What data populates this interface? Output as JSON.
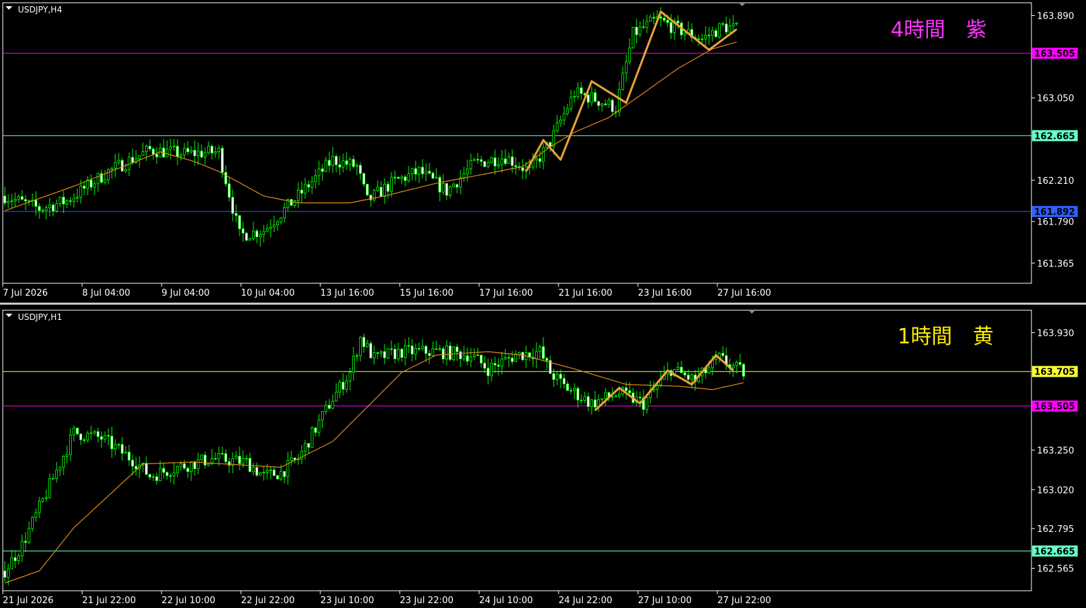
{
  "colors": {
    "background": "#000000",
    "bull": "#00ff00",
    "bear_fill": "#ffffff",
    "ma": "#e08a17",
    "zigzag": "#e8a33a",
    "axis": "#ffffff",
    "magenta": "#ff00ff",
    "cyan": "#66ffcc",
    "blue": "#2f5fff",
    "yellow": "#ffff33"
  },
  "chart_data": [
    {
      "type": "candlestick",
      "symbol": "USDJPY,H4",
      "title": "4時間　紫",
      "title_color": "#ff33ff",
      "ylim": [
        161.16,
        164.02
      ],
      "y_ticks": [
        "163.890",
        "163.050",
        "162.210",
        "161.790",
        "161.365"
      ],
      "x_labels": [
        "7 Jul 2026",
        "8 Jul 04:00",
        "9 Jul 04:00",
        "10 Jul 04:00",
        "13 Jul 16:00",
        "15 Jul 16:00",
        "17 Jul 16:00",
        "21 Jul 16:00",
        "23 Jul 16:00",
        "27 Jul 16:00"
      ],
      "levels": [
        {
          "value": 163.505,
          "label": "163.505",
          "color": "#ff00ff"
        },
        {
          "value": 162.665,
          "label": "162.665",
          "color": "#66ffcc"
        },
        {
          "value": 161.892,
          "label": "161.892",
          "color": "#2f5fff"
        }
      ],
      "anchors": [
        [
          0,
          162.05
        ],
        [
          10,
          161.92
        ],
        [
          18,
          162.0
        ],
        [
          30,
          162.3
        ],
        [
          42,
          162.52
        ],
        [
          52,
          162.48
        ],
        [
          62,
          162.5
        ],
        [
          68,
          161.65
        ],
        [
          75,
          161.7
        ],
        [
          85,
          162.05
        ],
        [
          95,
          162.42
        ],
        [
          102,
          162.35
        ],
        [
          105,
          162.0
        ],
        [
          113,
          162.2
        ],
        [
          120,
          162.3
        ],
        [
          128,
          162.1
        ],
        [
          136,
          162.38
        ],
        [
          145,
          162.45
        ],
        [
          152,
          162.3
        ],
        [
          158,
          162.6
        ],
        [
          165,
          163.1
        ],
        [
          170,
          163.05
        ],
        [
          177,
          162.95
        ],
        [
          182,
          163.7
        ],
        [
          189,
          163.85
        ],
        [
          195,
          163.75
        ],
        [
          202,
          163.65
        ],
        [
          208,
          163.78
        ],
        [
          212,
          163.75
        ]
      ],
      "ma_anchors": [
        [
          0,
          161.9
        ],
        [
          20,
          162.15
        ],
        [
          45,
          162.5
        ],
        [
          55,
          162.4
        ],
        [
          62,
          162.3
        ],
        [
          75,
          162.05
        ],
        [
          85,
          161.98
        ],
        [
          100,
          161.98
        ],
        [
          110,
          162.05
        ],
        [
          125,
          162.18
        ],
        [
          140,
          162.28
        ],
        [
          150,
          162.35
        ],
        [
          158,
          162.55
        ],
        [
          165,
          162.7
        ],
        [
          175,
          162.85
        ],
        [
          185,
          163.1
        ],
        [
          195,
          163.35
        ],
        [
          205,
          163.55
        ],
        [
          212,
          163.62
        ]
      ],
      "zigzag": [
        [
          151,
          162.3
        ],
        [
          156,
          162.62
        ],
        [
          161,
          162.42
        ],
        [
          170,
          163.22
        ],
        [
          180,
          163.0
        ],
        [
          190,
          163.93
        ],
        [
          204,
          163.54
        ],
        [
          212,
          163.75
        ]
      ]
    },
    {
      "type": "candlestick",
      "symbol": "USDJPY,H1",
      "title": "1時間　黄",
      "title_color": "#ffee00",
      "ylim": [
        162.435,
        164.06
      ],
      "y_ticks": [
        "163.930",
        "163.250",
        "163.020",
        "162.795",
        "162.565"
      ],
      "x_labels": [
        "21 Jul 2026",
        "21 Jul 22:00",
        "22 Jul 10:00",
        "22 Jul 22:00",
        "23 Jul 10:00",
        "23 Jul 22:00",
        "24 Jul 10:00",
        "24 Jul 22:00",
        "27 Jul 10:00",
        "27 Jul 22:00"
      ],
      "levels": [
        {
          "value": 163.705,
          "label": "163.705",
          "color": "#ffff33"
        },
        {
          "value": 163.505,
          "label": "163.505",
          "color": "#ff00ff"
        },
        {
          "value": 162.665,
          "label": "162.665",
          "color": "#66ffcc"
        }
      ],
      "anchors": [
        [
          0,
          162.55
        ],
        [
          5,
          162.7
        ],
        [
          12,
          163.0
        ],
        [
          20,
          163.35
        ],
        [
          28,
          163.32
        ],
        [
          38,
          163.18
        ],
        [
          42,
          163.1
        ],
        [
          50,
          163.15
        ],
        [
          60,
          163.2
        ],
        [
          70,
          163.18
        ],
        [
          75,
          163.1
        ],
        [
          80,
          163.12
        ],
        [
          85,
          163.2
        ],
        [
          95,
          163.55
        ],
        [
          100,
          163.7
        ],
        [
          103,
          163.9
        ],
        [
          107,
          163.78
        ],
        [
          115,
          163.82
        ],
        [
          125,
          163.82
        ],
        [
          135,
          163.8
        ],
        [
          140,
          163.72
        ],
        [
          148,
          163.8
        ],
        [
          155,
          163.82
        ],
        [
          158,
          163.7
        ],
        [
          162,
          163.62
        ],
        [
          170,
          163.52
        ],
        [
          178,
          163.58
        ],
        [
          185,
          163.52
        ],
        [
          193,
          163.72
        ],
        [
          200,
          163.65
        ],
        [
          207,
          163.78
        ],
        [
          212,
          163.72
        ],
        [
          214,
          163.7
        ]
      ],
      "ma_anchors": [
        [
          0,
          162.48
        ],
        [
          10,
          162.55
        ],
        [
          20,
          162.8
        ],
        [
          40,
          163.17
        ],
        [
          55,
          163.18
        ],
        [
          80,
          163.15
        ],
        [
          95,
          163.3
        ],
        [
          100,
          163.4
        ],
        [
          115,
          163.7
        ],
        [
          125,
          163.8
        ],
        [
          140,
          163.82
        ],
        [
          150,
          163.8
        ],
        [
          165,
          163.72
        ],
        [
          180,
          163.63
        ],
        [
          195,
          163.62
        ],
        [
          205,
          163.6
        ],
        [
          214,
          163.64
        ]
      ],
      "zigzag": [
        [
          171,
          163.48
        ],
        [
          178,
          163.61
        ],
        [
          184,
          163.52
        ],
        [
          192,
          163.71
        ],
        [
          199,
          163.63
        ],
        [
          206,
          163.8
        ],
        [
          211,
          163.71
        ]
      ]
    }
  ]
}
